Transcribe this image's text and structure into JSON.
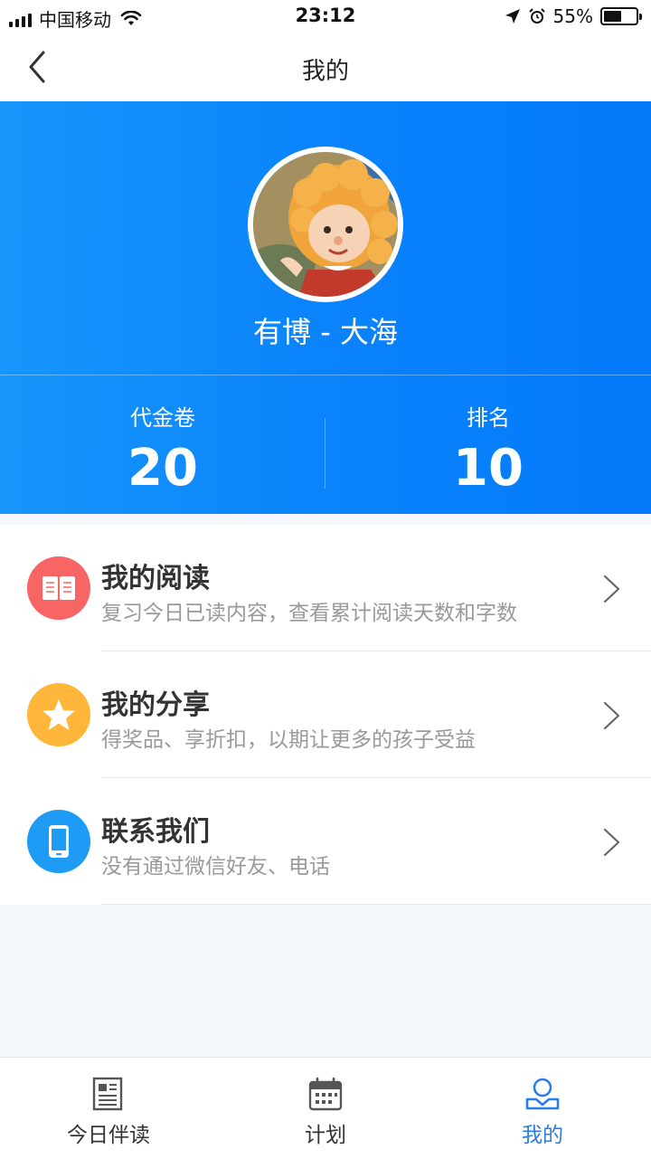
{
  "status_bar": {
    "carrier": "中国移动",
    "time": "23:12",
    "battery": "55%",
    "battery_level": 0.55
  },
  "navbar": {
    "title": "我的",
    "back_icon": "chevron-left-icon"
  },
  "profile": {
    "name": "有博 - 大海",
    "stats": [
      {
        "label": "代金卷",
        "value": "20"
      },
      {
        "label": "排名",
        "value": "10"
      }
    ]
  },
  "menu": [
    {
      "title": "我的阅读",
      "desc": "复习今日已读内容，查看累计阅读天数和字数",
      "icon": "book-icon",
      "color": "#f76565"
    },
    {
      "title": "我的分享",
      "desc": "得奖品、享折扣，以期让更多的孩子受益",
      "icon": "star-icon",
      "color": "#ffb63b"
    },
    {
      "title": "联系我们",
      "desc": "没有通过微信好友、电话",
      "icon": "phone-icon",
      "color": "#1e9cf5"
    }
  ],
  "tabs": [
    {
      "label": "今日伴读",
      "icon": "newspaper-icon",
      "active": false
    },
    {
      "label": "计划",
      "icon": "calendar-icon",
      "active": false
    },
    {
      "label": "我的",
      "icon": "user-icon",
      "active": true
    }
  ],
  "colors": {
    "header_gradient_start": "#1796fb",
    "header_gradient_end": "#0479fa",
    "active_tab": "#2a7ce8"
  }
}
